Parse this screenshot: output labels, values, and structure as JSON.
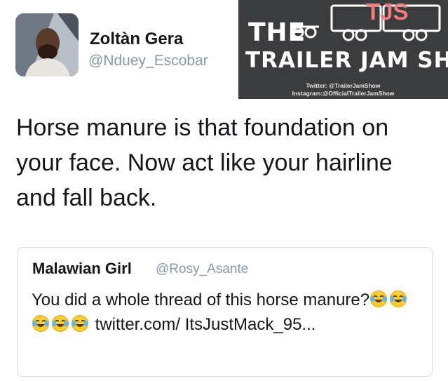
{
  "author": {
    "display_name": "Zoltàn Gera",
    "handle": "@Nduey_Escobar"
  },
  "watermark": {
    "the": "THE",
    "title": "TRAILER JAM SHOW",
    "logo": "TJS",
    "twitter": "Twitter: @TrailerJamShow",
    "instagram": "Instagram:@OfficialTrailerJamShow"
  },
  "tweet": {
    "text": "Horse manure is that foundation on your face. Now act like your hairline and fall back."
  },
  "quote": {
    "display_name": "Malawian Girl",
    "handle": "@Rosy_Asante",
    "text_before": "You did a whole thread of this horse manure?",
    "emoji_icon": "face-with-tears-of-joy-icon",
    "emoji_count": 5,
    "link_text": " twitter.com/ ItsJustMack_95..."
  },
  "colors": {
    "text": "#14171a",
    "secondary": "#8899a6",
    "watermark_bg": "#3b3c3e",
    "logo_accent": "#f37d7d",
    "card_border": "#d6dde3"
  }
}
